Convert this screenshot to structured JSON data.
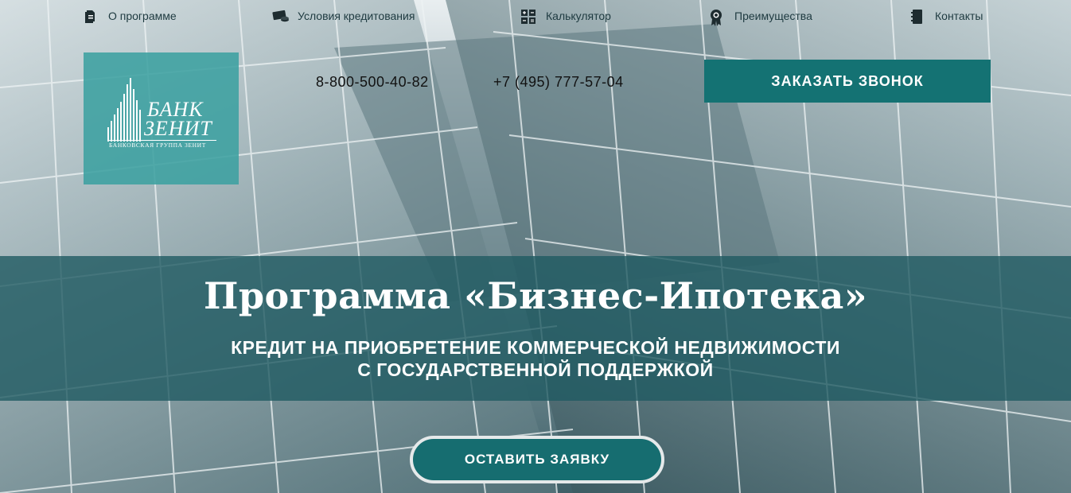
{
  "nav": {
    "items": [
      {
        "label": "О программе",
        "icon": "document-icon"
      },
      {
        "label": "Условия кредитования",
        "icon": "money-icon"
      },
      {
        "label": "Калькулятор",
        "icon": "calculator-icon"
      },
      {
        "label": "Преимущества",
        "icon": "award-icon"
      },
      {
        "label": "Контакты",
        "icon": "contacts-icon"
      }
    ]
  },
  "logo": {
    "line1": "БАНК",
    "line2": "ЗЕНИТ",
    "line3": "БАНКОВСКАЯ ГРУППА ЗЕНИТ"
  },
  "contacts": {
    "phone1": "8-800-500-40-82",
    "phone2": "+7 (495) 777-57-04"
  },
  "header": {
    "callback_label": "ЗАКАЗАТЬ ЗВОНОК"
  },
  "hero": {
    "title": "Программа «Бизнес-Ипотека»",
    "subtitle_line1": "КРЕДИТ НА ПРИОБРЕТЕНИЕ КОММЕРЧЕСКОЙ НЕДВИЖИМОСТИ",
    "subtitle_line2": "С ГОСУДАРСТВЕННОЙ ПОДДЕРЖКОЙ",
    "cta_label": "ОСТАВИТЬ ЗАЯВКУ"
  },
  "colors": {
    "accent": "#147273",
    "band": "#1f5a62",
    "logo_bg": "#3ca0a0"
  }
}
